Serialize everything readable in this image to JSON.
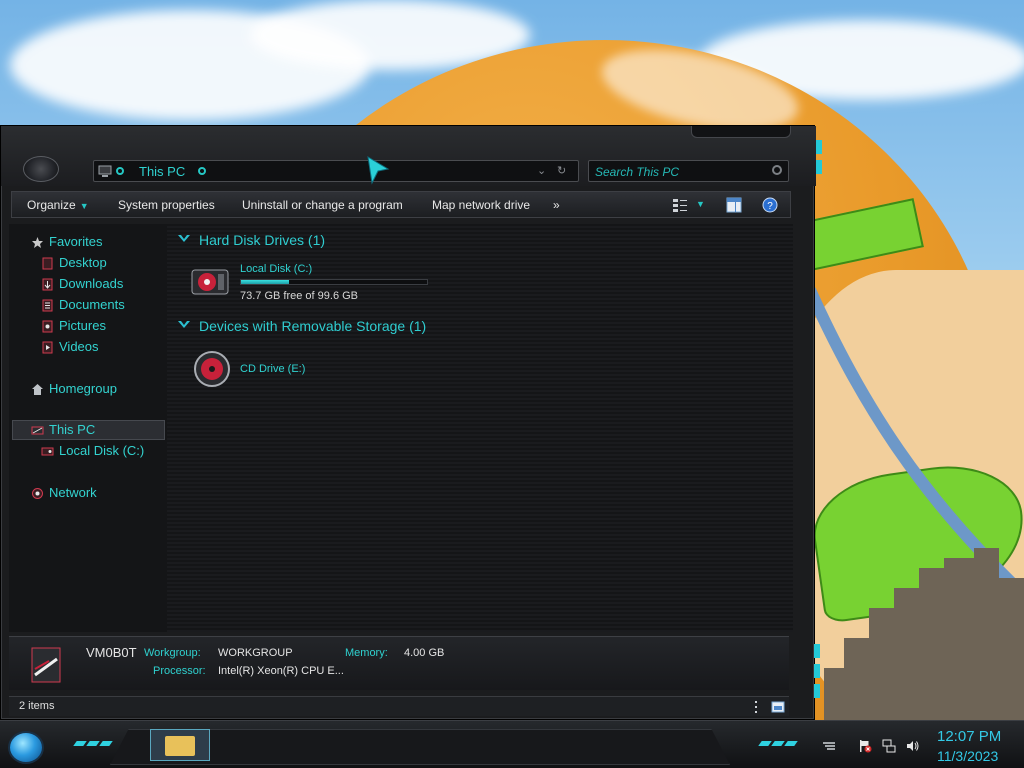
{
  "window": {
    "address": "This PC",
    "search_placeholder": "Search This PC"
  },
  "commandbar": {
    "organize": "Organize",
    "system_properties": "System properties",
    "uninstall": "Uninstall or change a program",
    "map_network_drive": "Map network drive",
    "more": "»"
  },
  "navpane": {
    "favorites": "Favorites",
    "desktop": "Desktop",
    "downloads": "Downloads",
    "documents": "Documents",
    "pictures": "Pictures",
    "videos": "Videos",
    "homegroup": "Homegroup",
    "this_pc": "This PC",
    "local_disk": "Local Disk (C:)",
    "network": "Network"
  },
  "content": {
    "hdd_group": "Hard Disk Drives (1)",
    "removable_group": "Devices with Removable Storage (1)",
    "drive_c": {
      "name": "Local Disk (C:)",
      "free_text": "73.7 GB free of 99.6 GB",
      "used_fraction": 0.26
    },
    "cd_drive": "CD Drive (E:)"
  },
  "details": {
    "computer_name": "VM0B0T",
    "workgroup_label": "Workgroup:",
    "workgroup_value": "WORKGROUP",
    "memory_label": "Memory:",
    "memory_value": "4.00 GB",
    "processor_label": "Processor:",
    "processor_value": "Intel(R) Xeon(R) CPU E..."
  },
  "statusbar": {
    "items": "2 items"
  },
  "taskbar": {
    "time": "12:07 PM",
    "date": "11/3/2023"
  },
  "colors": {
    "accent_cyan": "#2fd1cf",
    "window_bg": "#1b1c1e",
    "drive_red": "#c8213a"
  }
}
